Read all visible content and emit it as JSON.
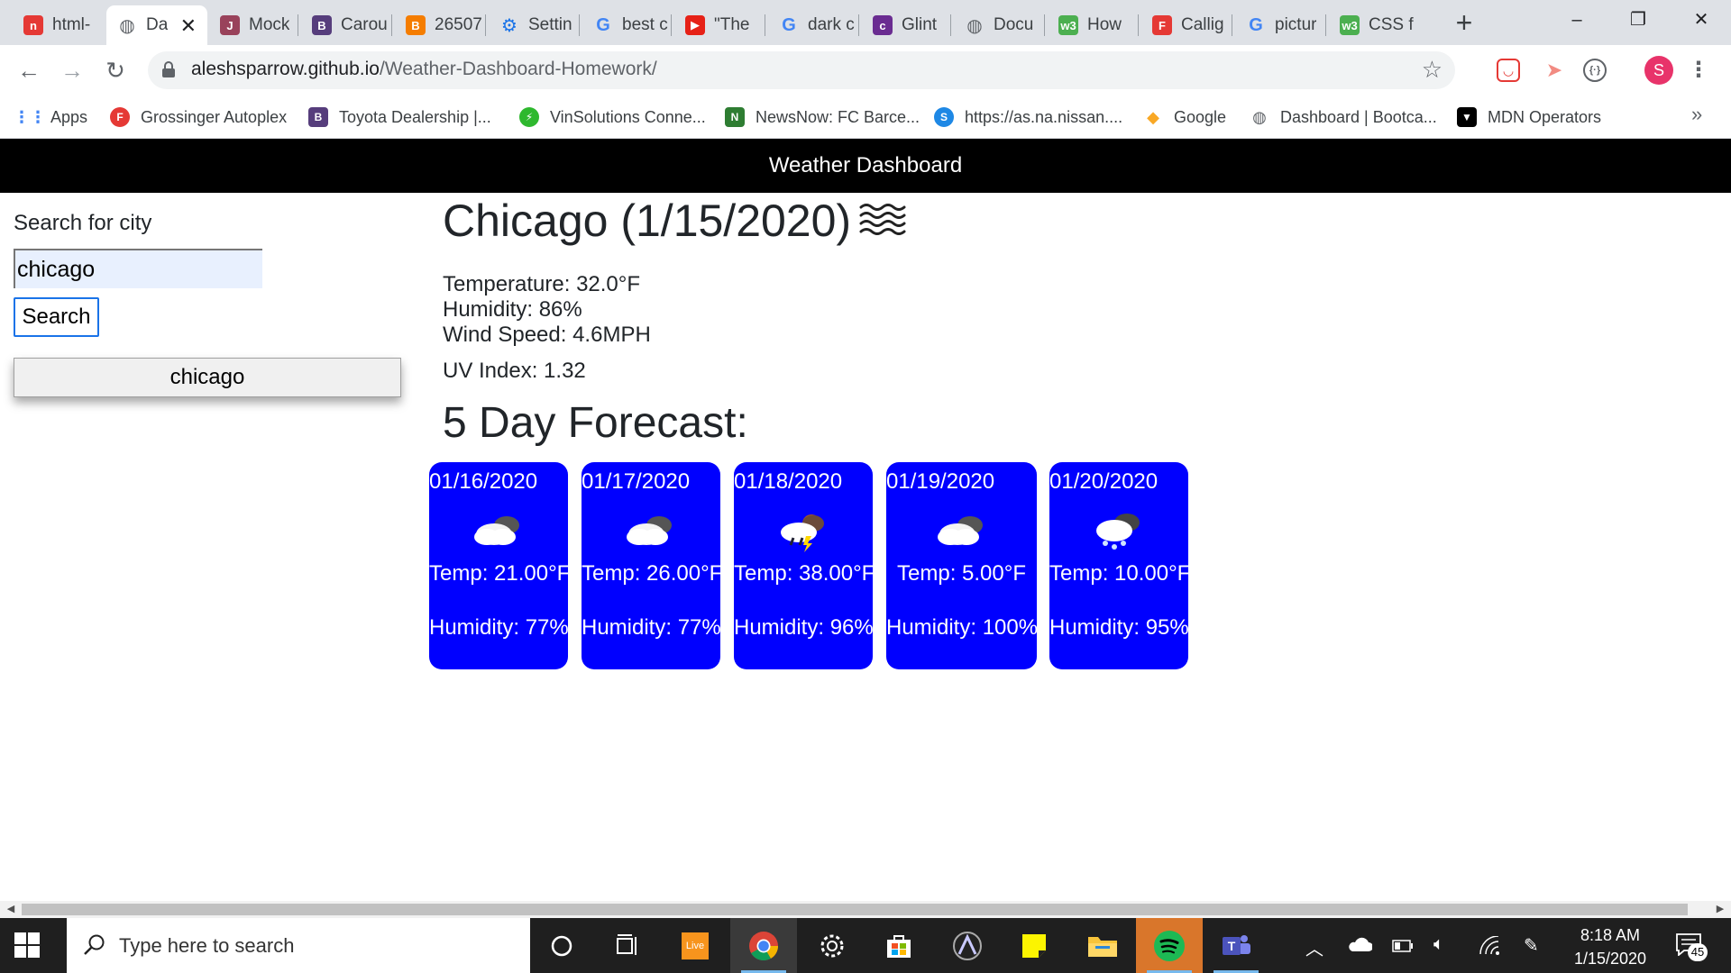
{
  "browser": {
    "tabs": [
      {
        "label": "html-",
        "icon": "red-n-icon",
        "color": "#e53935",
        "active": false
      },
      {
        "label": "Da",
        "icon": "globe-icon",
        "color": "#5f6368",
        "active": true
      },
      {
        "label": "Mock",
        "icon": "jest-icon",
        "color": "#99425b",
        "active": false
      },
      {
        "label": "Carou",
        "icon": "bootstrap-icon",
        "color": "#563d7c",
        "active": false
      },
      {
        "label": "26507",
        "icon": "blogger-icon",
        "color": "#f57d00",
        "active": false
      },
      {
        "label": "Settin",
        "icon": "settings-gear-icon",
        "color": "#1a73e8",
        "active": false
      },
      {
        "label": "best c",
        "icon": "google-icon",
        "color": "#4285f4",
        "active": false
      },
      {
        "label": "\"The",
        "icon": "youtube-icon",
        "color": "#e62117",
        "active": false
      },
      {
        "label": "dark c",
        "icon": "google-icon",
        "color": "#4285f4",
        "active": false
      },
      {
        "label": "Glint",
        "icon": "colorlib-icon",
        "color": "#6a2c91",
        "active": false
      },
      {
        "label": "Docu",
        "icon": "globe-icon",
        "color": "#5f6368",
        "active": false
      },
      {
        "label": "How",
        "icon": "w3schools-icon",
        "color": "#4caf50",
        "active": false
      },
      {
        "label": "Callig",
        "icon": "font-f-icon",
        "color": "#e53935",
        "active": false
      },
      {
        "label": "pictur",
        "icon": "google-icon",
        "color": "#4285f4",
        "active": false
      },
      {
        "label": "CSS f",
        "icon": "w3schools-icon",
        "color": "#4caf50",
        "active": false
      }
    ],
    "new_tab": "+",
    "window_controls": {
      "minimize": "–",
      "restore": "❐",
      "close": "✕"
    },
    "url": {
      "host": "aleshsparrow.github.io",
      "path": "/Weather-Dashboard-Homework/"
    },
    "bookmarks": [
      {
        "label": "Apps",
        "icon": "apps-grid-icon",
        "color": "#4285f4"
      },
      {
        "label": "Grossinger Autoplex",
        "icon": "font-f-icon",
        "color": "#e53935"
      },
      {
        "label": "Toyota Dealership |...",
        "icon": "bootstrap-icon",
        "color": "#563d7c"
      },
      {
        "label": "VinSolutions Conne...",
        "icon": "bolt-icon",
        "color": "#2eb82e"
      },
      {
        "label": "NewsNow: FC Barce...",
        "icon": "newsnow-icon",
        "color": "#2e7d32"
      },
      {
        "label": "https://as.na.nissan....",
        "icon": "nissan-icon",
        "color": "#1e88e5"
      },
      {
        "label": "Google",
        "icon": "google-bookmark-icon",
        "color": "#f9a825"
      },
      {
        "label": "Dashboard | Bootca...",
        "icon": "globe-icon",
        "color": "#5f6368"
      },
      {
        "label": "MDN Operators",
        "icon": "mdn-icon",
        "color": "#000000"
      }
    ],
    "bookmarks_more": "»",
    "profile_initial": "S"
  },
  "app": {
    "header_title": "Weather Dashboard",
    "search_heading": "Search for city",
    "search_value": "chicago",
    "search_button": "Search",
    "history": [
      "chicago"
    ],
    "current": {
      "title": "Chicago (1/15/2020)",
      "icon": "mist-icon",
      "temperature": "Temperature: 32.0°F",
      "humidity": "Humidity: 86%",
      "wind": "Wind Speed: 4.6MPH",
      "uv": "UV Index: 1.32"
    },
    "forecast_title": "5 Day Forecast:",
    "forecast": [
      {
        "date": "01/16/2020",
        "icon": "cloudy-icon",
        "temp": "Temp: 21.00°F",
        "humidity": "Humidity: 77%"
      },
      {
        "date": "01/17/2020",
        "icon": "cloudy-icon",
        "temp": "Temp: 26.00°F",
        "humidity": "Humidity: 77%"
      },
      {
        "date": "01/18/2020",
        "icon": "rain-cloud-icon",
        "temp": "Temp: 38.00°F",
        "humidity": "Humidity: 96%"
      },
      {
        "date": "01/19/2020",
        "icon": "cloudy-icon",
        "temp": "Temp: 5.00°F",
        "humidity": "Humidity: 100%"
      },
      {
        "date": "01/20/2020",
        "icon": "snow-cloud-icon",
        "temp": "Temp: 10.00°F",
        "humidity": "Humidity: 95%"
      }
    ]
  },
  "taskbar": {
    "search_placeholder": "Type here to search",
    "apps": [
      "cortana-icon",
      "task-view-icon",
      "live-icon",
      "chrome-icon",
      "settings-icon",
      "store-icon",
      "affinity-icon",
      "sticky-notes-icon",
      "file-explorer-icon",
      "spotify-icon",
      "teams-icon"
    ],
    "live_label": "Live",
    "time": "8:18 AM",
    "date": "1/15/2020",
    "notification_count": "45"
  }
}
